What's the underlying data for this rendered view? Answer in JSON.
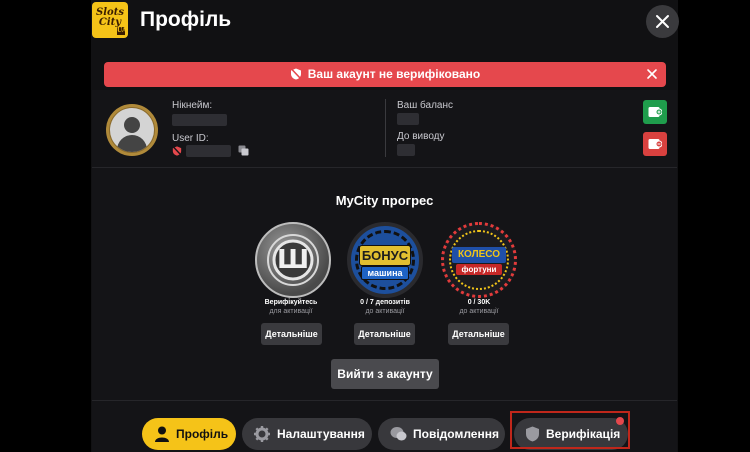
{
  "header": {
    "logo_text": "Slots City",
    "logo_badge": "UA",
    "title": "Профіль"
  },
  "alert": {
    "message": "Ваш акаунт не верифіковано"
  },
  "user": {
    "nickname_label": "Нікнейм:",
    "user_id_label": "User ID:",
    "balance_label": "Ваш баланс",
    "withdraw_label": "До виводу"
  },
  "progress": {
    "title": "MyCity прогрес",
    "items": [
      {
        "badge": "Ш",
        "status": "Верифікуйтесь",
        "sub": "для активації",
        "button": "Детальніше"
      },
      {
        "badge_top": "БОНУС",
        "badge_bottom": "машина",
        "status": "0 / 7 депозитів",
        "sub": "до активації",
        "button": "Детальніше"
      },
      {
        "badge_top": "КОЛЕСО",
        "badge_bottom": "фортуни",
        "status": "0 / 30K",
        "sub": "до активації",
        "button": "Детальніше"
      }
    ]
  },
  "logout_label": "Вийти з акаунту",
  "tabs": [
    {
      "label": "Профіль",
      "icon": "user-icon",
      "active": true
    },
    {
      "label": "Налаштування",
      "icon": "gear-icon",
      "active": false
    },
    {
      "label": "Повідомлення",
      "icon": "chat-icon",
      "active": false
    },
    {
      "label": "Верифікація",
      "icon": "shield-icon",
      "active": false
    }
  ],
  "colors": {
    "accent": "#f5c318",
    "alert": "#e5484d",
    "deposit_green": "#1f9d4c",
    "withdraw_red": "#d9413f",
    "highlight": "#c0271b"
  }
}
